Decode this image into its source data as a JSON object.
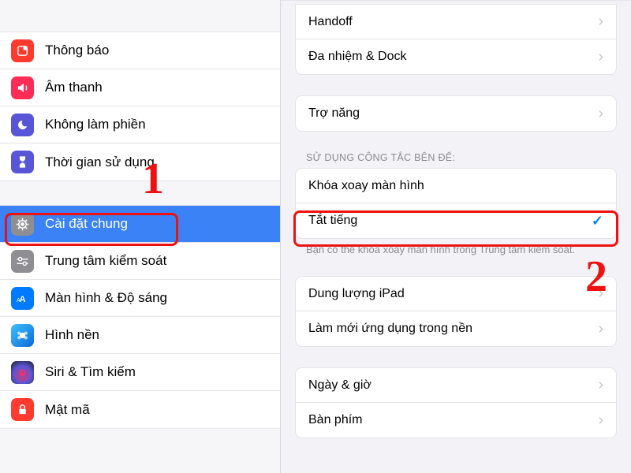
{
  "sidebar": {
    "group1": [
      {
        "label": "Thông báo",
        "icon_bg": "#ff3b30",
        "icon": "notifications-icon"
      },
      {
        "label": "Âm thanh",
        "icon_bg": "#ff2d55",
        "icon": "sound-icon"
      },
      {
        "label": "Không làm phiền",
        "icon_bg": "#5856d6",
        "icon": "dnd-icon"
      },
      {
        "label": "Thời gian sử dụng",
        "icon_bg": "#5856d6",
        "icon": "screentime-icon"
      }
    ],
    "group2": [
      {
        "label": "Cài đặt chung",
        "icon_bg": "#8e8e93",
        "icon": "general-icon",
        "selected": true
      },
      {
        "label": "Trung tâm kiểm soát",
        "icon_bg": "#8e8e93",
        "icon": "control-center-icon"
      },
      {
        "label": "Màn hình & Độ sáng",
        "icon_bg": "#007aff",
        "icon": "display-icon"
      },
      {
        "label": "Hình nền",
        "icon_bg": "#33c1d9",
        "icon": "wallpaper-icon"
      },
      {
        "label": "Siri & Tìm kiếm",
        "icon_bg": "#1c1c1e",
        "icon": "siri-icon"
      },
      {
        "label": "Mật mã",
        "icon_bg": "#ff3b30",
        "icon": "passcode-icon"
      }
    ]
  },
  "detail": {
    "group_top": [
      {
        "label": "Handoff",
        "type": "chevron"
      },
      {
        "label": "Đa nhiệm & Dock",
        "type": "chevron"
      }
    ],
    "group_access": [
      {
        "label": "Trợ năng",
        "type": "chevron"
      }
    ],
    "side_switch_header": "SỬ DỤNG CÔNG TẮC BÊN ĐỂ:",
    "side_switch": [
      {
        "label": "Khóa xoay màn hình",
        "type": "none"
      },
      {
        "label": "Tắt tiếng",
        "type": "check"
      }
    ],
    "side_switch_footer": "Bạn có thể khóa xoay màn hình trong Trung tâm kiểm soát.",
    "group_storage": [
      {
        "label": "Dung lượng iPad",
        "type": "chevron"
      },
      {
        "label": "Làm mới ứng dụng trong nền",
        "type": "chevron"
      }
    ],
    "group_time": [
      {
        "label": "Ngày & giờ",
        "type": "chevron"
      },
      {
        "label": "Bàn phím",
        "type": "chevron"
      }
    ]
  },
  "annotations": {
    "num1": "1",
    "num2": "2"
  }
}
